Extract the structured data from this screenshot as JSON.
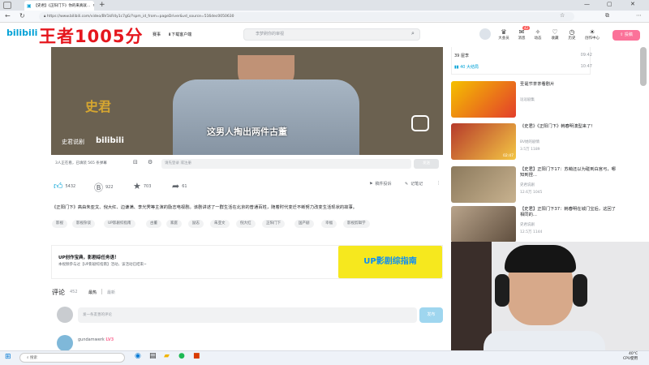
{
  "browser": {
    "tab_title": "【史君】《正阳门下》你的来真就...",
    "url": "https://www.bilibili.com/video/BV1kR4y1c7gG/?spm_id_from=pageDriver&vd_source=516dec0050630"
  },
  "header": {
    "logo": "bilibili",
    "overlay_text": "王者1005分",
    "nav_left": [
      "赛事",
      "下载客户端"
    ],
    "search_placeholder": "李梦刷你的审视",
    "nav_right": [
      "大会员",
      "消息",
      "动态",
      "收藏",
      "历史",
      "创作中心"
    ],
    "message_badge": "42",
    "upload": "投稿"
  },
  "video": {
    "subtitle": "这男人掏出两件古董",
    "watermark_big": "史君",
    "watermark_name": "史君说剧",
    "watermark_logo": "bilibili"
  },
  "danmaku": {
    "watching": "3人正在看，已填装 565 条弹幕",
    "input_placeholder": "请先登录 或注册",
    "send": "发送"
  },
  "actions": {
    "like": "5432",
    "coin": "922",
    "fav": "703",
    "share": "61",
    "report": "稿件投诉",
    "note": "记笔记"
  },
  "description": "《正阳门下》高由朱亚文、倪大红、边谦满、李光霁等主演的励志电视剧。该剧讲述了一群生活在北京的普通百姓，随着时代变迁不断努力改变生活现状的故事。",
  "tags": [
    "影视",
    "影视杂谈",
    "UP影剧综指南",
    "古董",
    "家庭",
    "励志",
    "朱亚文",
    "倪大红",
    "正阳门下",
    "国产剧",
    "幸福",
    "影视剪辑学"
  ],
  "banner": {
    "title": "UP创作宝典，影剧综任务语！",
    "subtitle": "本视频参与过【UP影剧综指南】活动，该活动已结束~",
    "image_text": "UP影剧综指南"
  },
  "comments": {
    "title": "评论",
    "count": "452",
    "sort_hot": "最热",
    "sort_new": "最新",
    "input_placeholder": "发一条友善的评论",
    "post": "发布",
    "first_user": "gundamwerk",
    "first_level": "LV3"
  },
  "danmaku_list": [
    {
      "text": "39 屋李",
      "time": "09:42"
    },
    {
      "text": "40 大结局",
      "time": "10:47"
    }
  ],
  "recommendations": [
    {
      "title": "圣诞节茶茶看剧片",
      "up": "逗逗剧集",
      "stats": "",
      "duration": ""
    },
    {
      "title": "《史君》《正阳门下》韩春明澳型来了!",
      "up": "BV她的剧情",
      "stats": "3.5万  1189",
      "duration": "02:47"
    },
    {
      "title": "【史君】正阳门下17：苏萌还以为碰到白宫弓，哪知到捏...",
      "up": "史君说剧",
      "stats": "12.6万  1045",
      "duration": ""
    },
    {
      "title": "【史君】正阳门下37：韩春明在城门宝后，这回了相同的...",
      "up": "史君说剧",
      "stats": "12.5万  1144",
      "duration": ""
    }
  ],
  "taskbar": {
    "search": "搜索",
    "time": "40°C",
    "cpu": "CPU使用"
  },
  "colors": {
    "bili_blue": "#00a1d6",
    "bili_pink": "#fb7299",
    "overlay_red": "#e5161d"
  }
}
